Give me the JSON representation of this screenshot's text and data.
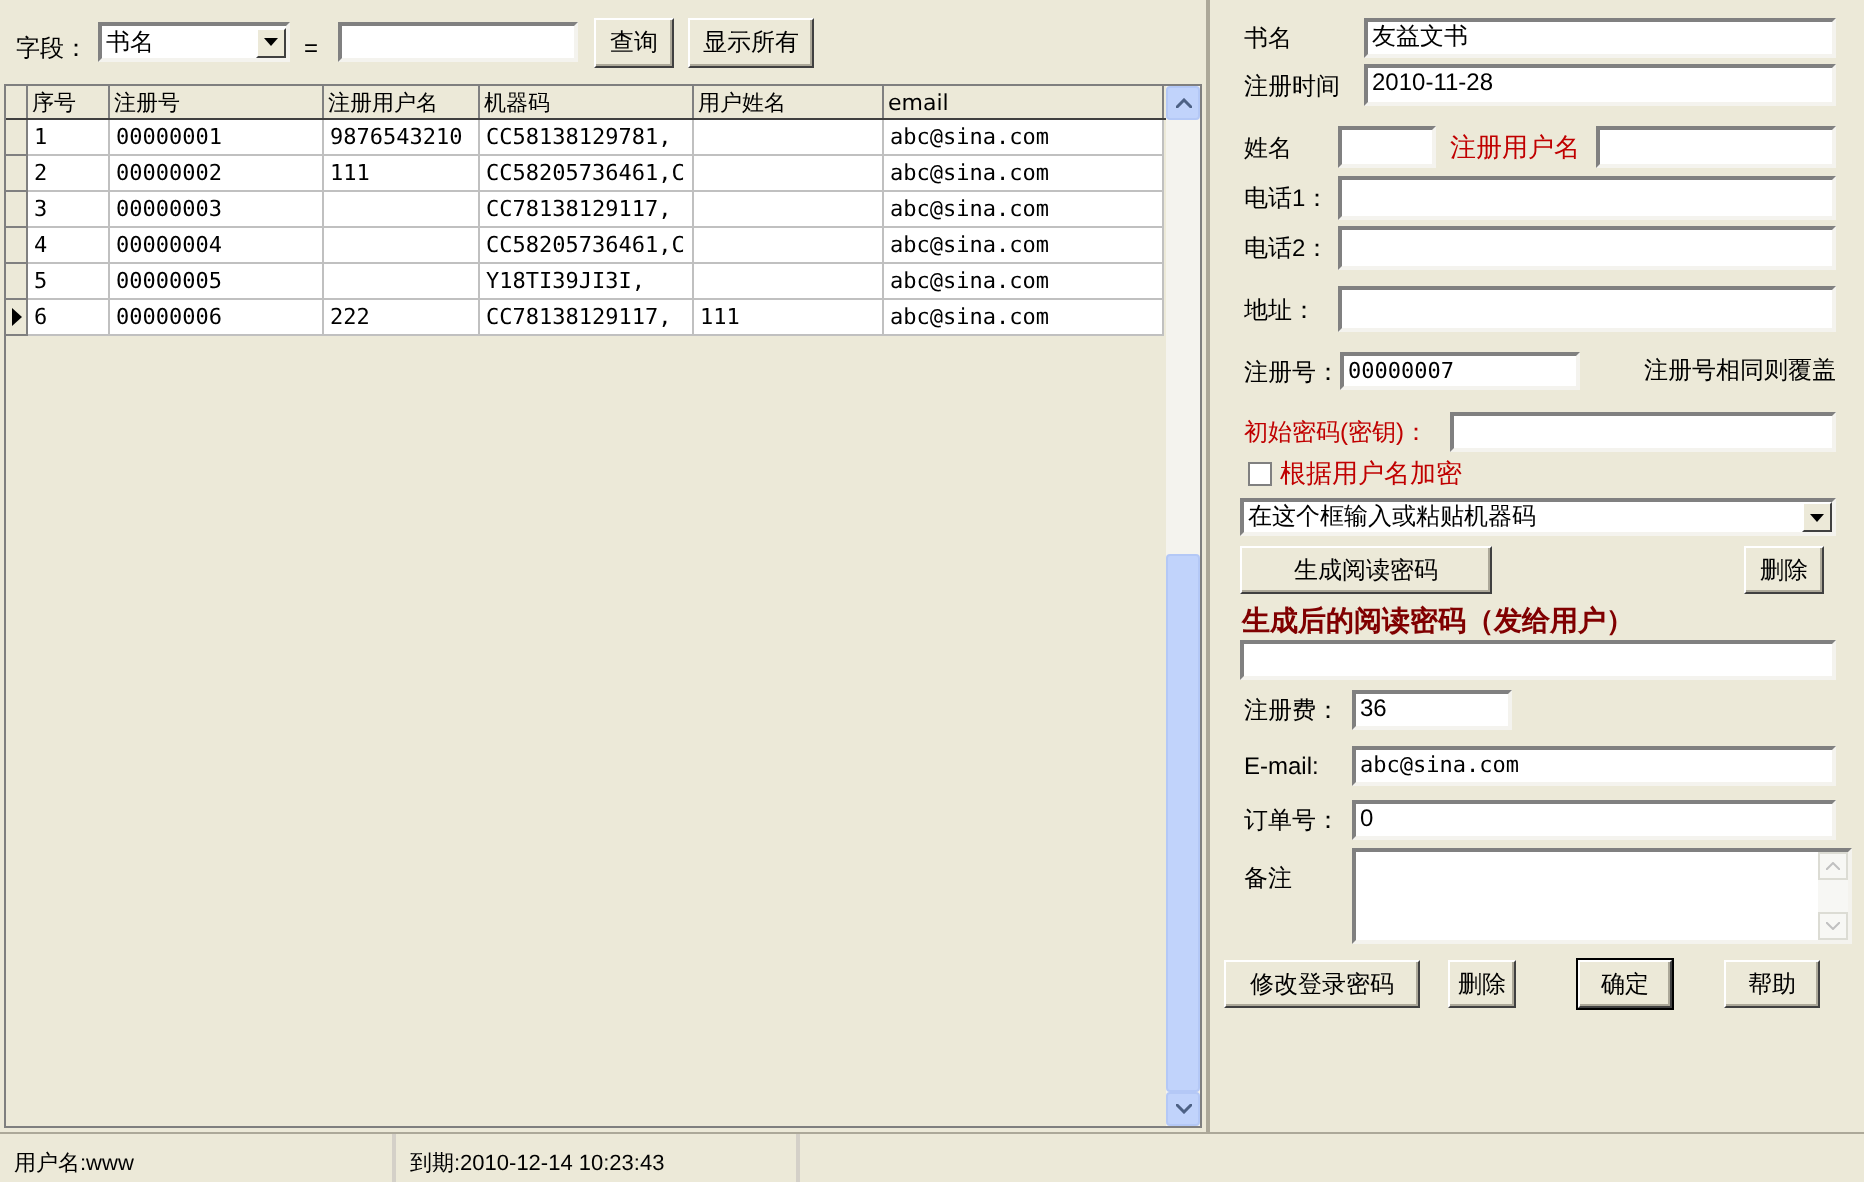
{
  "toolbar": {
    "field_label": "字段：",
    "field_select": "书名",
    "equals": "=",
    "buttons": [
      "查询",
      "显示所有"
    ]
  },
  "grid": {
    "columns": [
      "序号",
      "注册号",
      "注册用户名",
      "机器码",
      "用户姓名",
      "email"
    ],
    "rows": [
      {
        "cells": [
          "1",
          "00000001",
          "9876543210",
          "CC58138129781,",
          "",
          "abc@sina.com"
        ],
        "selected": false
      },
      {
        "cells": [
          "2",
          "00000002",
          "111",
          "CC58205736461,C",
          "",
          "abc@sina.com"
        ],
        "selected": false
      },
      {
        "cells": [
          "3",
          "00000003",
          "",
          "CC78138129117,",
          "",
          "abc@sina.com"
        ],
        "selected": false
      },
      {
        "cells": [
          "4",
          "00000004",
          "",
          "CC58205736461,C",
          "",
          "abc@sina.com"
        ],
        "selected": false
      },
      {
        "cells": [
          "5",
          "00000005",
          "",
          "Y18TI39JI3I,",
          "",
          "abc@sina.com"
        ],
        "selected": false
      },
      {
        "cells": [
          "6",
          "00000006",
          "222",
          "CC78138129117,",
          "111",
          "abc@sina.com"
        ],
        "selected": true
      }
    ]
  },
  "form": {
    "book_name": {
      "label": "书名",
      "value": "友益文书"
    },
    "reg_time": {
      "label": "注册时间",
      "value": "2010-11-28"
    },
    "name": {
      "label": "姓名"
    },
    "reg_user": {
      "label": "注册用户名"
    },
    "phone1": {
      "label": "电话1："
    },
    "phone2": {
      "label": "电话2："
    },
    "address": {
      "label": "地址："
    },
    "reg_no": {
      "label": "注册号：",
      "value": "00000007",
      "note": "注册号相同则覆盖"
    },
    "init_key": {
      "label": "初始密码(密钥)："
    },
    "encrypt_by_user": {
      "label": "根据用户名加密",
      "checked": false
    },
    "machine_code": {
      "value": "在这个框输入或粘贴机器码"
    },
    "generate_button": "生成阅读密码",
    "delete_button": "删除",
    "result_heading": "生成后的阅读密码（发给用户）",
    "fee": {
      "label": "注册费：",
      "value": "36"
    },
    "email": {
      "label": "E-mail:",
      "value": "abc@sina.com"
    },
    "order_no": {
      "label": "订单号：",
      "value": "0"
    },
    "notes": {
      "label": "备注"
    },
    "buttons": [
      {
        "label": "修改登录密码",
        "default": false
      },
      {
        "label": "删除",
        "default": false
      },
      {
        "label": "确定",
        "default": true
      },
      {
        "label": "帮助",
        "default": false
      }
    ]
  },
  "status_bar": [
    "用户名:www",
    "到期:2010-12-14 10:23:43"
  ]
}
